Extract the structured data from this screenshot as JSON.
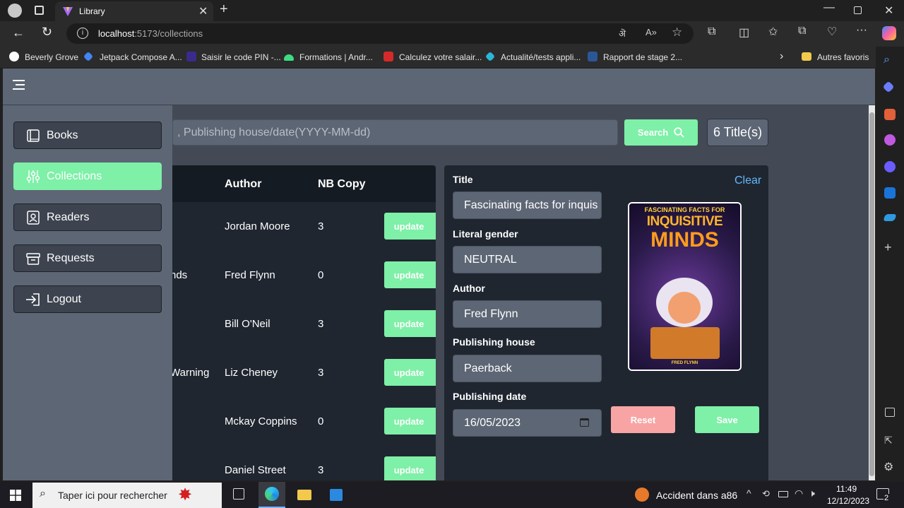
{
  "browser": {
    "tab_title": "Library",
    "url_host": "localhost",
    "url_path": ":5173/collections",
    "bookmarks": [
      "Beverly Grove",
      "Jetpack Compose A...",
      "Saisir le code PIN -...",
      "Formations | Andr...",
      "Calculez votre salair...",
      "Actualité/tests appli...",
      "Rapport de stage 2..."
    ],
    "other_favorites": "Autres favoris"
  },
  "sidebar": {
    "items": [
      {
        "label": "Books",
        "icon": "book-icon"
      },
      {
        "label": "Collections",
        "icon": "sliders-icon"
      },
      {
        "label": "Readers",
        "icon": "user-card-icon"
      },
      {
        "label": "Requests",
        "icon": "inbox-icon"
      },
      {
        "label": "Logout",
        "icon": "logout-icon"
      }
    ]
  },
  "search": {
    "placeholder_visible": ", Publishing house/date(YYYY-MM-dd)",
    "button_label": "Search",
    "count_label": "6 Title(s)"
  },
  "table": {
    "headers": {
      "author": "Author",
      "copies": "NB Copy"
    },
    "rows": [
      {
        "title_fragment": "",
        "author": "Jordan Moore",
        "copies": "3",
        "action": "update"
      },
      {
        "title_fragment": "nds",
        "author": "Fred Flynn",
        "copies": "0",
        "action": "update"
      },
      {
        "title_fragment": "",
        "author": "Bill O'Neil",
        "copies": "3",
        "action": "update"
      },
      {
        "title_fragment": "Warning",
        "author": "Liz Cheney",
        "copies": "3",
        "action": "update"
      },
      {
        "title_fragment": "",
        "author": "Mckay Coppins",
        "copies": "0",
        "action": "update"
      },
      {
        "title_fragment": "",
        "author": "Daniel Street",
        "copies": "3",
        "action": "update"
      }
    ]
  },
  "form": {
    "clear_label": "Clear",
    "title_label": "Title",
    "title_value": "Fascinating facts for inquis",
    "gender_label": "Literal gender",
    "gender_value": "NEUTRAL",
    "author_label": "Author",
    "author_value": "Fred Flynn",
    "publisher_label": "Publishing house",
    "publisher_value": "Paerback",
    "date_label": "Publishing date",
    "date_value": "16/05/2023",
    "reset_label": "Reset",
    "save_label": "Save",
    "cover": {
      "line1": "FASCINATING FACTS FOR",
      "line2": "INQUISITIVE",
      "line3": "MINDS",
      "author": "FRED FLYNN"
    }
  },
  "taskbar": {
    "search_placeholder": "Taper ici pour rechercher",
    "notification": "Accident dans a86",
    "time": "11:49",
    "date": "12/12/2023",
    "badge": "2"
  },
  "colors": {
    "accent_green": "#7ef0a7",
    "danger_pink": "#f8a4a4",
    "panel_dark": "#1f2630",
    "link_blue": "#62b9ff"
  }
}
